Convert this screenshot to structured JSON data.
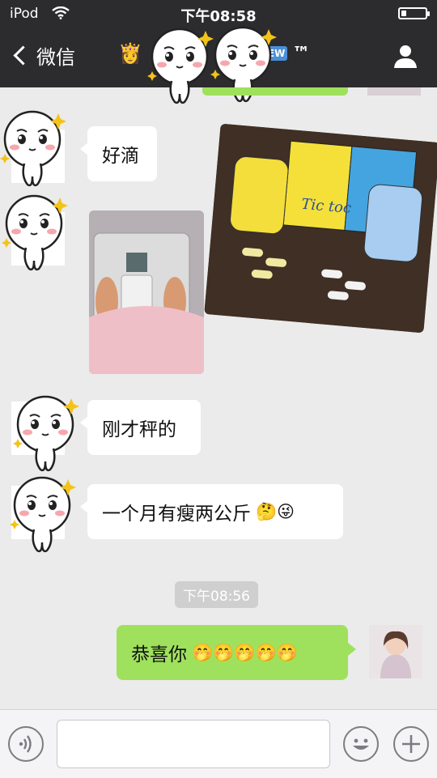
{
  "status_bar": {
    "carrier": "iPod",
    "time": "下午08:58",
    "battery_level": 0.2
  },
  "nav": {
    "back_label": "微信",
    "title_emoji": "👸",
    "title_badge": "NEW",
    "title_suffix": "™"
  },
  "messages": [
    {
      "type": "text",
      "side": "left",
      "text": "好滴"
    },
    {
      "type": "image",
      "side": "left",
      "alt": "feet on bathroom scale"
    },
    {
      "type": "image",
      "side": "none",
      "alt": "product boxes and capsules",
      "label": "Tic toc"
    },
    {
      "type": "text",
      "side": "left",
      "text": "刚才秤的"
    },
    {
      "type": "text",
      "side": "left",
      "text": "一个月有瘦两公斤",
      "emojis": "🤔😜"
    },
    {
      "type": "time",
      "text": "下午08:56"
    },
    {
      "type": "text",
      "side": "right",
      "text": "恭喜你",
      "emojis": "🤭🤭🤭🤭🤭"
    }
  ],
  "icons": {
    "voice": "voice-icon",
    "smiley": "smiley-icon",
    "plus": "plus-icon",
    "person": "person-icon"
  },
  "colors": {
    "topbar": "#2c2c2e",
    "chat_bg": "#ebebeb",
    "right_bubble": "#9fe15c",
    "left_bubble": "#ffffff"
  },
  "input": {
    "value": "",
    "placeholder": ""
  }
}
